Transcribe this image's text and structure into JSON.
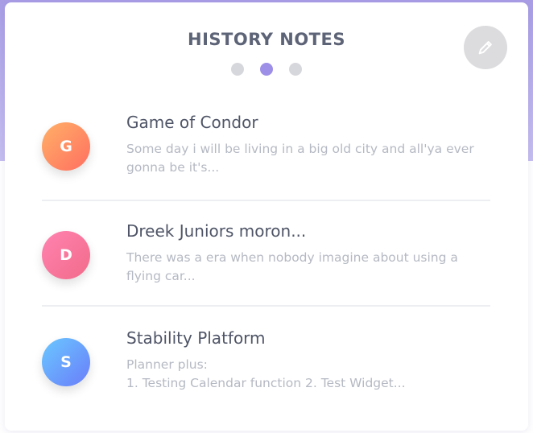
{
  "header": {
    "title": "HISTORY NOTES",
    "page_count": 3,
    "active_page": 2
  },
  "edit_button": {
    "icon": "pencil-icon"
  },
  "colors": {
    "accent": "#9d8fe8",
    "title_text": "#5e6477",
    "body_text": "#b5b9c3"
  },
  "notes": [
    {
      "initial": "G",
      "title": "Game of Condor",
      "body": "Some day i will be living in a big old city and all'ya ever gonna be it's..."
    },
    {
      "initial": "D",
      "title": "Dreek Juniors moron...",
      "body": "There was a era when nobody imagine about using a flying car..."
    },
    {
      "initial": "S",
      "title": "Stability Platform",
      "body_line1": "Planner plus:",
      "body_line2": "1. Testing Calendar function 2. Test Widget..."
    }
  ]
}
